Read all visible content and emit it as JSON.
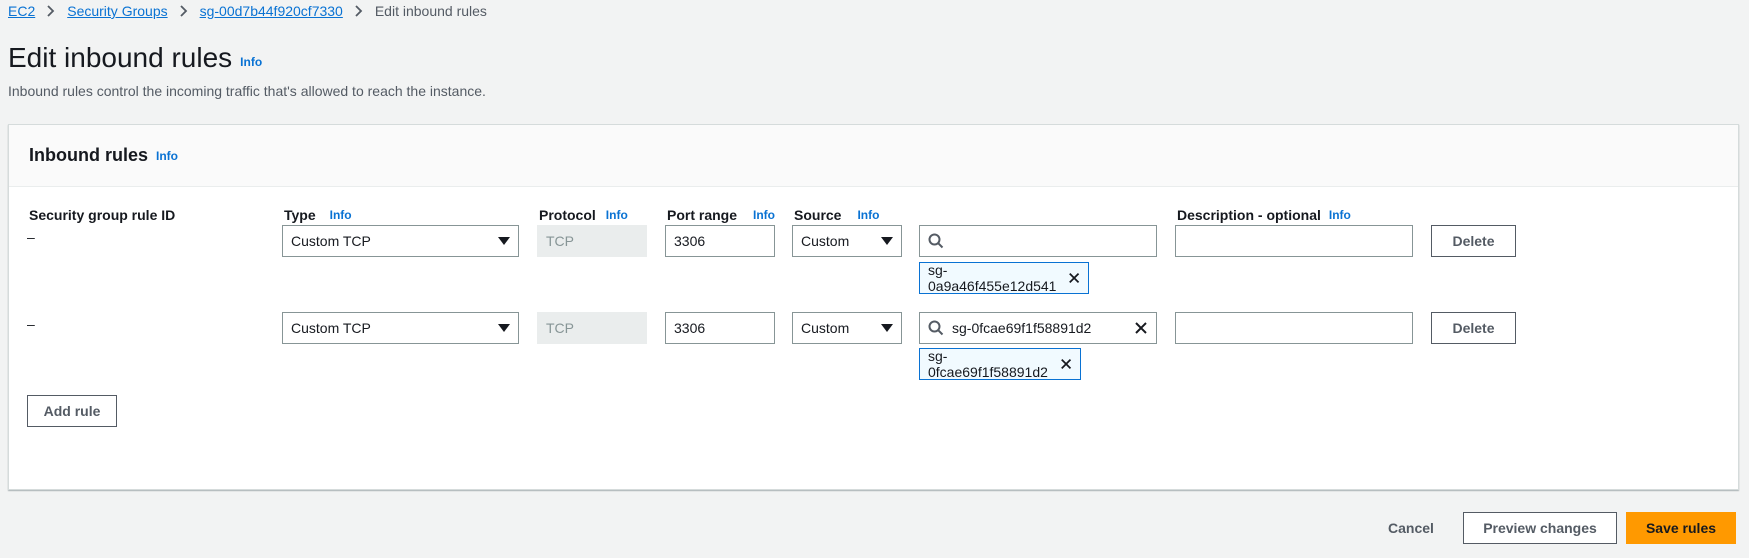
{
  "breadcrumb": {
    "items": [
      "EC2",
      "Security Groups",
      "sg-00d7b44f920cf7330"
    ],
    "current": "Edit inbound rules",
    "separator": ">"
  },
  "page": {
    "title": "Edit inbound rules",
    "title_info": "Info",
    "subtitle": "Inbound rules control the incoming traffic that's allowed to reach the instance."
  },
  "panel": {
    "title": "Inbound rules",
    "title_info": "Info",
    "columns": {
      "rule_id": "Security group rule ID",
      "type": "Type",
      "protocol": "Protocol",
      "port_range": "Port range",
      "source": "Source",
      "description": "Description - optional",
      "info": "Info"
    },
    "rows": [
      {
        "rule_id": "–",
        "type": "Custom TCP",
        "protocol": "TCP",
        "port_range": "3306",
        "source": "Custom",
        "search_value": "",
        "token": "sg-0a9a46f455e12d541",
        "description": "",
        "delete": "Delete"
      },
      {
        "rule_id": "–",
        "type": "Custom TCP",
        "protocol": "TCP",
        "port_range": "3306",
        "source": "Custom",
        "search_value": "sg-0fcae69f1f58891d2",
        "token": "sg-0fcae69f1f58891d2",
        "description": "",
        "delete": "Delete"
      }
    ],
    "add_rule": "Add rule"
  },
  "footer": {
    "cancel": "Cancel",
    "preview": "Preview changes",
    "save": "Save rules"
  },
  "colors": {
    "link": "#0972d3",
    "primary": "#ff9900",
    "background": "#f2f3f3",
    "token_border": "#0972d3"
  },
  "icons": [
    "chevron-right-icon",
    "caret-down-icon",
    "search-icon",
    "close-icon"
  ]
}
